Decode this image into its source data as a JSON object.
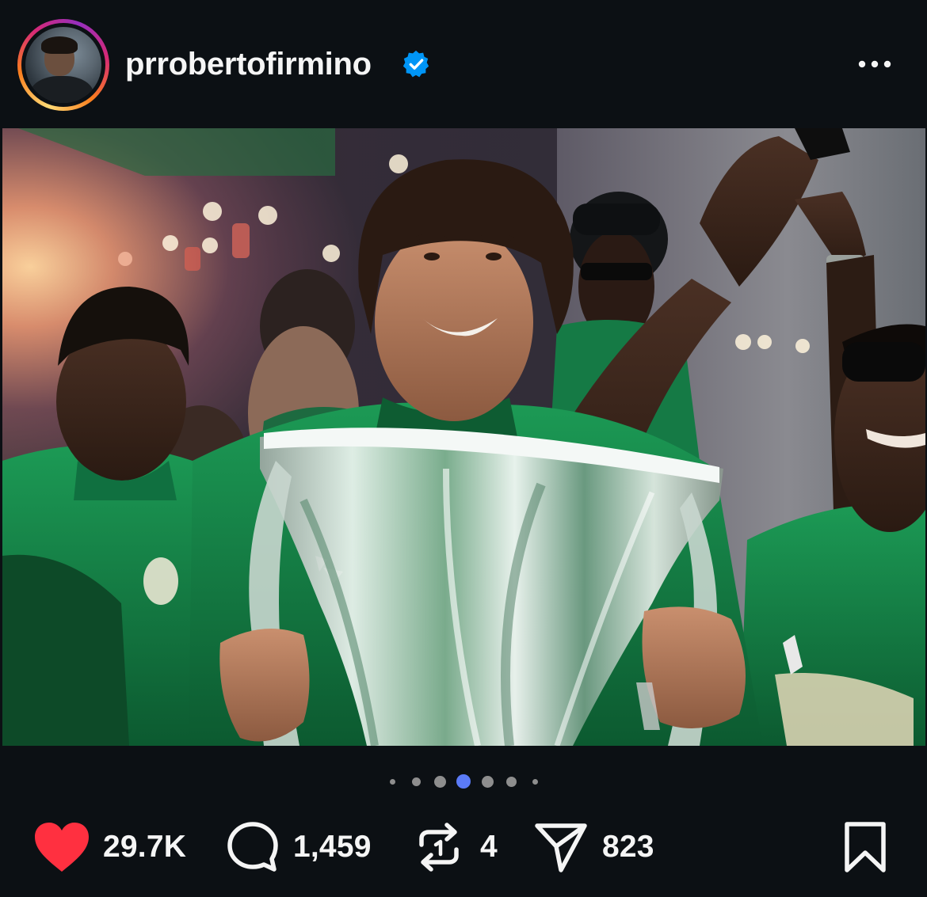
{
  "header": {
    "username": "prrobertofirmino",
    "verified_icon": "verified-badge-icon",
    "more_icon": "more-options-icon"
  },
  "post": {
    "image_alt": "photo"
  },
  "carousel": {
    "total_dots": 7,
    "active_index": 3
  },
  "actions": {
    "like_count": "29.7K",
    "comment_count": "1,459",
    "repost_count": "4",
    "share_count": "823",
    "liked": true
  },
  "colors": {
    "background": "#0c1014",
    "text": "#f5f5f5",
    "like_red": "#ff3040",
    "verified_blue": "#0095f6",
    "active_dot": "#5b7bf7"
  }
}
